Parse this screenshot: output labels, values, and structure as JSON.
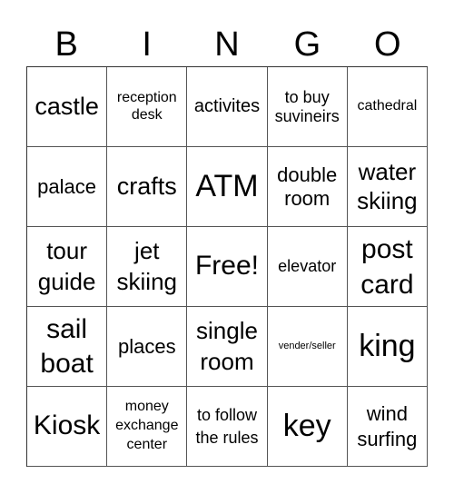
{
  "header": [
    "B",
    "I",
    "N",
    "G",
    "O"
  ],
  "cells": [
    [
      "castle",
      "reception desk",
      "activites",
      "to buy suvineirs",
      "cathedral"
    ],
    [
      "palace",
      "crafts",
      "ATM",
      "double room",
      "water skiing"
    ],
    [
      "tour guide",
      "jet skiing",
      "Free!",
      "elevator",
      "post card"
    ],
    [
      "sail boat",
      "places",
      "single room",
      "vender/seller",
      "king"
    ],
    [
      "Kiosk",
      "money exchange center",
      "to follow the rules",
      "key",
      "wind surfing"
    ]
  ]
}
